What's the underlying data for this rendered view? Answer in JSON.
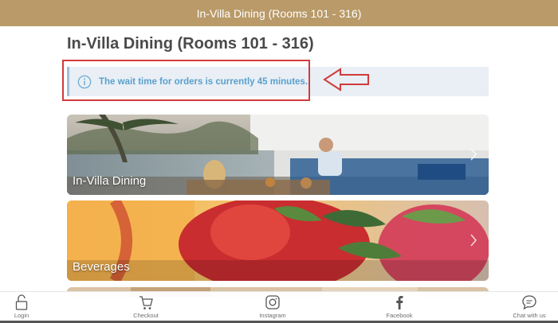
{
  "header": {
    "title": "In-Villa Dining (Rooms 101 - 316)"
  },
  "page": {
    "title": "In-Villa Dining (Rooms 101 - 316)"
  },
  "notice": {
    "text": "The wait time for orders is currently 45 minutes.",
    "icon": "info-icon"
  },
  "annotation": {
    "box_color": "#d23b3b",
    "arrow_color": "#d23b3b"
  },
  "cards": [
    {
      "label": "In-Villa Dining"
    },
    {
      "label": "Beverages"
    }
  ],
  "nav": {
    "login": "Login",
    "checkout": "Checkout",
    "instagram": "Instagram",
    "facebook": "Facebook",
    "chat": "Chat with us"
  },
  "colors": {
    "brand": "#b99a68",
    "notice_text": "#5aa0cc",
    "notice_bg": "#e9eff5"
  }
}
